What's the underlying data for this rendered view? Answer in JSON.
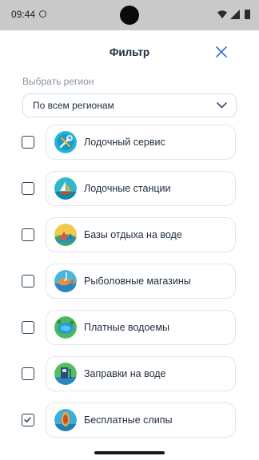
{
  "status_bar": {
    "time": "09:44"
  },
  "header": {
    "title": "Фильтр"
  },
  "region": {
    "label": "Выбрать регион",
    "selected": "По всем регионам"
  },
  "categories": [
    {
      "label": "Лодочный сервис",
      "checked": false,
      "icon": "wrench-icon"
    },
    {
      "label": "Лодочные станции",
      "checked": false,
      "icon": "sailboat-icon"
    },
    {
      "label": "Базы отдыха на воде",
      "checked": false,
      "icon": "campsite-icon"
    },
    {
      "label": "Рыболовные магазины",
      "checked": false,
      "icon": "fishing-hook-icon"
    },
    {
      "label": "Платные водоемы",
      "checked": false,
      "icon": "pond-icon"
    },
    {
      "label": "Заправки на воде",
      "checked": false,
      "icon": "fuel-pump-icon"
    },
    {
      "label": "Бесплатные слипы",
      "checked": true,
      "icon": "slipway-icon"
    }
  ],
  "colors": {
    "accent": "#3a6fd8",
    "text": "#1e2d3d",
    "muted": "#8a95a3",
    "border": "#e1e6ed",
    "status_bar": "#c9c9c9"
  }
}
